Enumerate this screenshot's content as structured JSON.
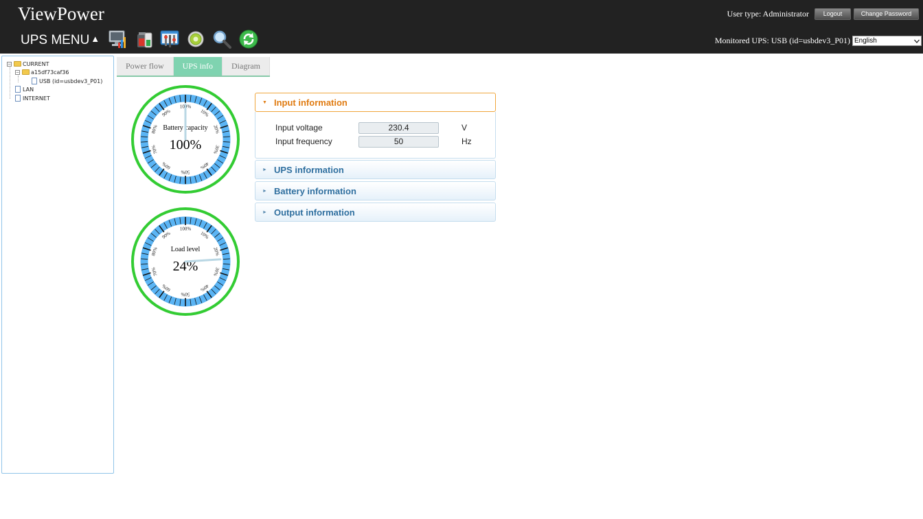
{
  "header": {
    "app_title": "ViewPower",
    "user_type": "User type: Administrator",
    "logout_label": "Logout",
    "change_password_label": "Change Password",
    "menu_label": "UPS MENU",
    "menu_arrow": "▲",
    "monitored_ups": "Monitored UPS: USB (id=usbdev3_P01)",
    "language": "English",
    "toolbar_icons": [
      "monitor-chart-icon",
      "battery-tools-icon",
      "configuration-icon",
      "settings-gear-icon",
      "search-icon",
      "refresh-icon"
    ]
  },
  "tree": {
    "root": "CURRENT",
    "node": "a15df73caf36",
    "device": "USB (id=usbdev3_P01)",
    "lan": "LAN",
    "internet": "INTERNET"
  },
  "tabs": [
    {
      "label": "Power flow",
      "active": false
    },
    {
      "label": "UPS info",
      "active": true
    },
    {
      "label": "Diagram",
      "active": false
    }
  ],
  "gauges": {
    "battery": {
      "label": "Battery capacity",
      "value_text": "100%",
      "value": 100
    },
    "load": {
      "label": "Load level",
      "value_text": "24%",
      "value": 24
    },
    "tick_labels": [
      "100%",
      "10%",
      "20%",
      "30%",
      "40%",
      "50%",
      "60%",
      "70%",
      "80%",
      "90%"
    ],
    "ring_color": "#33cc33",
    "band_color": "#5ab4f4"
  },
  "accordion": {
    "input": {
      "title": "Input information",
      "voltage_label": "Input voltage",
      "voltage_value": "230.4",
      "voltage_unit": "V",
      "frequency_label": "Input frequency",
      "frequency_value": "50",
      "frequency_unit": "Hz"
    },
    "ups": {
      "title": "UPS information"
    },
    "battery": {
      "title": "Battery information"
    },
    "output": {
      "title": "Output information"
    }
  }
}
